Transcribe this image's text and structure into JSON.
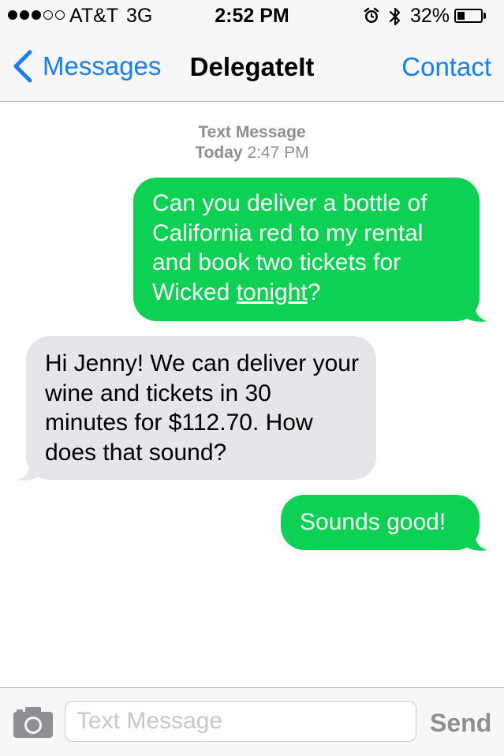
{
  "status_bar": {
    "carrier": "AT&T",
    "network": "3G",
    "time": "2:52 PM",
    "battery_percent": "32%",
    "battery_level": 0.32,
    "signal_bars_filled": 3,
    "signal_bars_total": 5,
    "icons": [
      "alarm-icon",
      "bluetooth-icon",
      "battery-icon"
    ]
  },
  "nav": {
    "back_label": "Messages",
    "title": "DelegateIt",
    "contact_label": "Contact",
    "accent_color": "#157efb"
  },
  "thread": {
    "header_type": "Text Message",
    "header_day": "Today",
    "header_time": "2:47 PM"
  },
  "messages": [
    {
      "direction": "sent",
      "text_before_link": "Can you deliver a bottle of California red to my rental and book two tickets for Wicked ",
      "link_text": "tonight",
      "text_after_link": "?"
    },
    {
      "direction": "received",
      "text": "Hi Jenny! We can deliver your wine and tickets in 30 minutes for $112.70. How does that sound?"
    },
    {
      "direction": "sent",
      "text": "Sounds good!"
    }
  ],
  "colors": {
    "sent_bubble": "#0dd152",
    "received_bubble": "#e5e5ea",
    "bars_background": "#f7f7f7"
  },
  "input_bar": {
    "camera_icon": "camera-icon",
    "placeholder": "Text Message",
    "value": "",
    "send_label": "Send"
  }
}
